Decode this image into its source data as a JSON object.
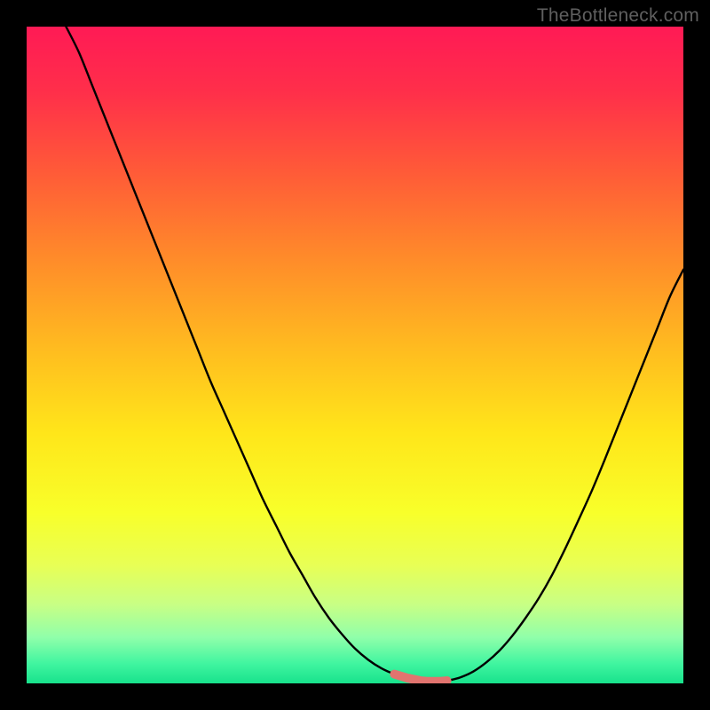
{
  "watermark": {
    "text": "TheBottleneck.com"
  },
  "colors": {
    "black": "#000000",
    "curve": "#000000",
    "highlight": "#e1746f",
    "gradient_stops": [
      {
        "offset": 0,
        "color": "#ff1a55"
      },
      {
        "offset": 0.1,
        "color": "#ff2f4a"
      },
      {
        "offset": 0.22,
        "color": "#ff5a38"
      },
      {
        "offset": 0.35,
        "color": "#ff8a2a"
      },
      {
        "offset": 0.5,
        "color": "#ffbf1f"
      },
      {
        "offset": 0.62,
        "color": "#ffe61a"
      },
      {
        "offset": 0.74,
        "color": "#f8ff2a"
      },
      {
        "offset": 0.82,
        "color": "#e8ff55"
      },
      {
        "offset": 0.88,
        "color": "#c8ff85"
      },
      {
        "offset": 0.93,
        "color": "#90ffaa"
      },
      {
        "offset": 0.97,
        "color": "#40f5a0"
      },
      {
        "offset": 1.0,
        "color": "#18e28c"
      }
    ]
  },
  "chart_data": {
    "type": "line",
    "title": "",
    "xlabel": "",
    "ylabel": "",
    "xlim": [
      0,
      100
    ],
    "ylim": [
      0,
      100
    ],
    "grid": false,
    "legend": false,
    "x": [
      6,
      8,
      10,
      12,
      14,
      16,
      18,
      20,
      22,
      24,
      26,
      28,
      30,
      32,
      34,
      36,
      38,
      40,
      42,
      44,
      46,
      48,
      50,
      52,
      54,
      56,
      58,
      60,
      61,
      62,
      63,
      64,
      66,
      68,
      70,
      72,
      74,
      76,
      78,
      80,
      82,
      84,
      86,
      88,
      90,
      92,
      94,
      96,
      98,
      100
    ],
    "values": [
      100,
      96,
      91,
      86,
      81,
      76,
      71,
      66,
      61,
      56,
      51,
      46,
      41.5,
      37,
      32.5,
      28,
      24,
      20,
      16.5,
      13,
      10,
      7.5,
      5.3,
      3.6,
      2.3,
      1.4,
      0.8,
      0.4,
      0.3,
      0.3,
      0.3,
      0.4,
      0.9,
      1.8,
      3.2,
      5,
      7.3,
      10,
      13,
      16.5,
      20.5,
      24.8,
      29.2,
      34,
      39,
      44,
      49,
      54,
      59,
      63
    ],
    "highlight_range_x": [
      55,
      64
    ],
    "notes": "V-shaped bottleneck curve; y ≈ 0 near x 60–63; background hue encodes y (red high → green low)."
  }
}
